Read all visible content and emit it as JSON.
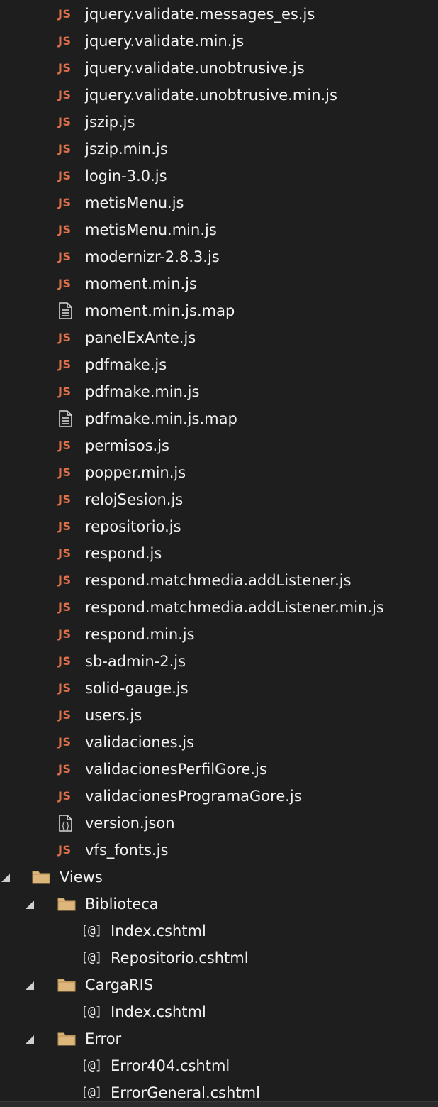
{
  "colors": {
    "background": "#1e1e1e",
    "text": "#f1f1f1",
    "js_icon": "#e0704a",
    "folder_fill": "#dcb67a",
    "expander": "#cfcfcf"
  },
  "items": [
    {
      "label": "jquery.validate.messages_es.js",
      "icon": "js",
      "indent": 1
    },
    {
      "label": "jquery.validate.min.js",
      "icon": "js",
      "indent": 1
    },
    {
      "label": "jquery.validate.unobtrusive.js",
      "icon": "js",
      "indent": 1
    },
    {
      "label": "jquery.validate.unobtrusive.min.js",
      "icon": "js",
      "indent": 1
    },
    {
      "label": "jszip.js",
      "icon": "js",
      "indent": 1
    },
    {
      "label": "jszip.min.js",
      "icon": "js",
      "indent": 1
    },
    {
      "label": "login-3.0.js",
      "icon": "js",
      "indent": 1
    },
    {
      "label": "metisMenu.js",
      "icon": "js",
      "indent": 1
    },
    {
      "label": "metisMenu.min.js",
      "icon": "js",
      "indent": 1
    },
    {
      "label": "modernizr-2.8.3.js",
      "icon": "js",
      "indent": 1
    },
    {
      "label": "moment.min.js",
      "icon": "js",
      "indent": 1
    },
    {
      "label": "moment.min.js.map",
      "icon": "doc",
      "indent": 1
    },
    {
      "label": "panelExAnte.js",
      "icon": "js",
      "indent": 1
    },
    {
      "label": "pdfmake.js",
      "icon": "js",
      "indent": 1
    },
    {
      "label": "pdfmake.min.js",
      "icon": "js",
      "indent": 1
    },
    {
      "label": "pdfmake.min.js.map",
      "icon": "doc",
      "indent": 1
    },
    {
      "label": "permisos.js",
      "icon": "js",
      "indent": 1
    },
    {
      "label": "popper.min.js",
      "icon": "js",
      "indent": 1
    },
    {
      "label": "relojSesion.js",
      "icon": "js",
      "indent": 1
    },
    {
      "label": "repositorio.js",
      "icon": "js",
      "indent": 1
    },
    {
      "label": "respond.js",
      "icon": "js",
      "indent": 1
    },
    {
      "label": "respond.matchmedia.addListener.js",
      "icon": "js",
      "indent": 1
    },
    {
      "label": "respond.matchmedia.addListener.min.js",
      "icon": "js",
      "indent": 1
    },
    {
      "label": "respond.min.js",
      "icon": "js",
      "indent": 1
    },
    {
      "label": "sb-admin-2.js",
      "icon": "js",
      "indent": 1
    },
    {
      "label": "solid-gauge.js",
      "icon": "js",
      "indent": 1
    },
    {
      "label": "users.js",
      "icon": "js",
      "indent": 1
    },
    {
      "label": "validaciones.js",
      "icon": "js",
      "indent": 1
    },
    {
      "label": "validacionesPerfilGore.js",
      "icon": "js",
      "indent": 1
    },
    {
      "label": "validacionesProgramaGore.js",
      "icon": "js",
      "indent": 1
    },
    {
      "label": "version.json",
      "icon": "json",
      "indent": 1
    },
    {
      "label": "vfs_fonts.js",
      "icon": "js",
      "indent": 1
    },
    {
      "label": "Views",
      "icon": "folder",
      "indent": 0,
      "expanded": true
    },
    {
      "label": "Biblioteca",
      "icon": "folder",
      "indent": 1,
      "expanded": true
    },
    {
      "label": "Index.cshtml",
      "icon": "razor",
      "indent": 2
    },
    {
      "label": "Repositorio.cshtml",
      "icon": "razor",
      "indent": 2
    },
    {
      "label": "CargaRIS",
      "icon": "folder",
      "indent": 1,
      "expanded": true
    },
    {
      "label": "Index.cshtml",
      "icon": "razor",
      "indent": 2
    },
    {
      "label": "Error",
      "icon": "folder",
      "indent": 1,
      "expanded": true
    },
    {
      "label": "Error404.cshtml",
      "icon": "razor",
      "indent": 2
    },
    {
      "label": "ErrorGeneral.cshtml",
      "icon": "razor",
      "indent": 2
    }
  ]
}
